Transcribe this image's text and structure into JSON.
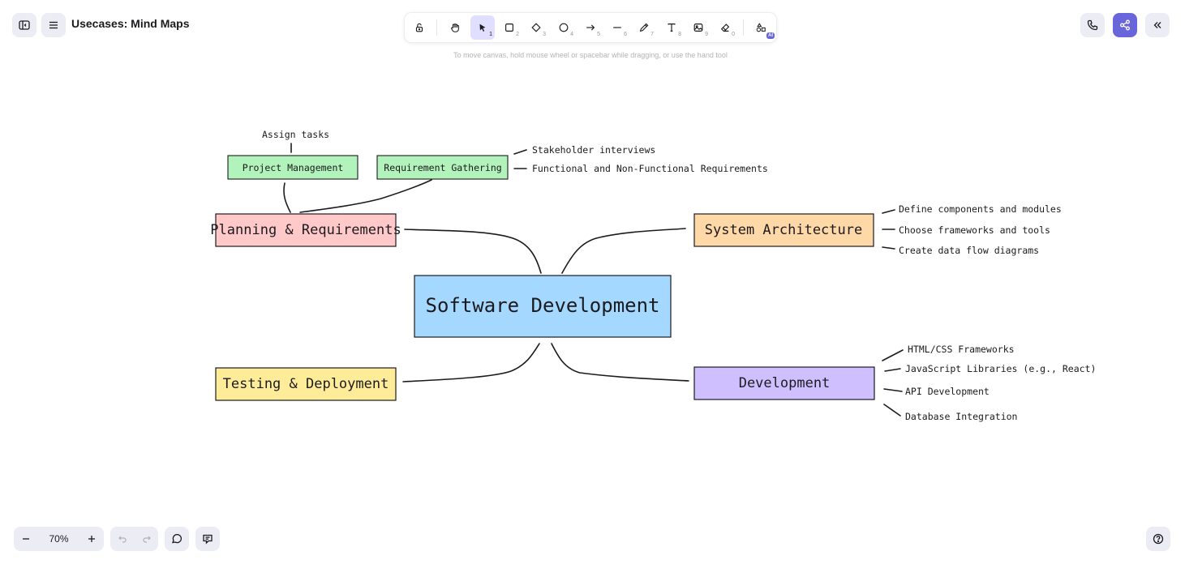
{
  "app": {
    "title": "Usecases: Mind Maps"
  },
  "toolbar": {
    "tools": [
      {
        "name": "lock",
        "key": ""
      },
      {
        "name": "hand",
        "key": ""
      },
      {
        "name": "selection",
        "key": "1"
      },
      {
        "name": "rectangle",
        "key": "2"
      },
      {
        "name": "diamond",
        "key": "3"
      },
      {
        "name": "ellipse",
        "key": "4"
      },
      {
        "name": "arrow",
        "key": "5"
      },
      {
        "name": "line",
        "key": "6"
      },
      {
        "name": "draw",
        "key": "7"
      },
      {
        "name": "text",
        "key": "8"
      },
      {
        "name": "image",
        "key": "9"
      },
      {
        "name": "eraser",
        "key": "0"
      },
      {
        "name": "ai-tools",
        "key": ""
      }
    ],
    "ai_badge": "AI",
    "hint": "To move canvas, hold mouse wheel or spacebar while dragging, or use the hand tool",
    "active_tool": "selection"
  },
  "mindmap": {
    "central": "Software Development",
    "nodes": {
      "planning": "Planning & Requirements",
      "architecture": "System Architecture",
      "testing": "Testing & Deployment",
      "development": "Development"
    },
    "subnodes": {
      "project_management": "Project Management",
      "requirement_gathering": "Requirement Gathering"
    },
    "notes": {
      "assign_tasks": "Assign tasks",
      "stakeholder": "Stakeholder interviews",
      "functional": "Functional and Non-Functional Requirements",
      "arch_1": "Define components and modules",
      "arch_2": "Choose frameworks and tools",
      "arch_3": "Create data flow diagrams",
      "dev_1": "HTML/CSS Frameworks",
      "dev_2": "JavaScript Libraries (e.g., React)",
      "dev_3": "API Development",
      "dev_4": "Database Integration"
    },
    "colors": {
      "central": "#a5d8ff",
      "planning": "#ffc9c9",
      "architecture": "#ffd8a8",
      "testing": "#ffec99",
      "development": "#d0bfff",
      "subnode": "#b2f2bb"
    }
  },
  "footer": {
    "zoom": "70%"
  },
  "colors": {
    "accent": "#6965db",
    "button_bg": "#ececf4"
  }
}
